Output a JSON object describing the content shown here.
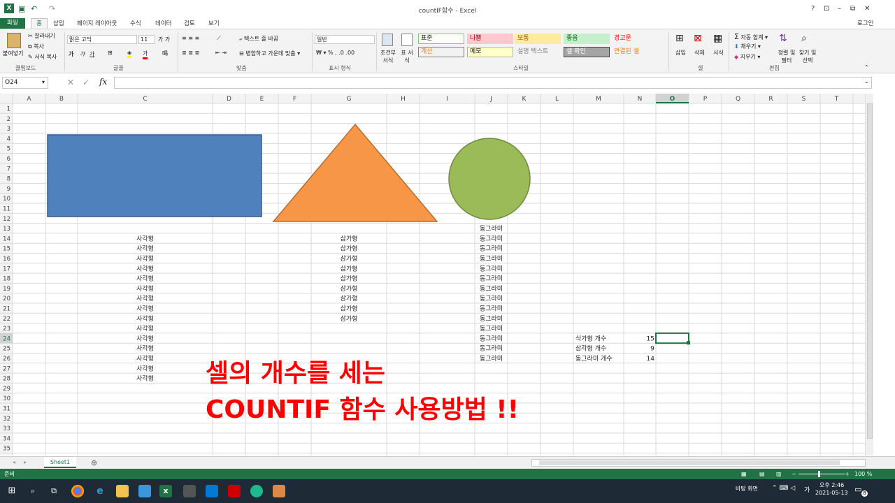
{
  "window": {
    "title": "countIF함수 - Excel",
    "login": "로그인",
    "controls": [
      "?",
      "⊡",
      "–",
      "⧉",
      "✕"
    ]
  },
  "tabs": [
    "파일",
    "홈",
    "삽입",
    "페이지 레이아웃",
    "수식",
    "데이터",
    "검토",
    "보기"
  ],
  "ribbon": {
    "clipboard": {
      "paste": "붙여넣기",
      "cut": "잘라내기",
      "copy": "복사",
      "format_painter": "서식 복사",
      "label": "클립보드"
    },
    "font": {
      "name": "맑은 고딕",
      "size": "11",
      "label": "글꼴",
      "bold": "가",
      "italic": "가",
      "underline": "가"
    },
    "align": {
      "wrap": "텍스트 줄 바꿈",
      "merge": "병합하고 가운데 맞춤",
      "label": "맞춤"
    },
    "number": {
      "format": "일반",
      "label": "표시 형식"
    },
    "styles": {
      "conditional": "조건부 서식",
      "table": "표 서식",
      "label": "스타일",
      "cells": [
        {
          "text": "표준",
          "bg": "#ffffff",
          "fg": "#222222",
          "border": "#7fc67f"
        },
        {
          "text": "나쁨",
          "bg": "#ffc7ce",
          "fg": "#9c0006",
          "border": "#ffc7ce"
        },
        {
          "text": "보통",
          "bg": "#ffeb9c",
          "fg": "#9c5700",
          "border": "#ffeb9c"
        },
        {
          "text": "좋음",
          "bg": "#c6efce",
          "fg": "#006100",
          "border": "#c6efce"
        },
        {
          "text": "경고문",
          "bg": "#f3f3f3",
          "fg": "#ff0000",
          "border": "#f3f3f3"
        },
        {
          "text": "계산",
          "bg": "#f2f2f2",
          "fg": "#fa7d00",
          "border": "#7f7f7f"
        },
        {
          "text": "메모",
          "bg": "#ffffcc",
          "fg": "#222222",
          "border": "#b2b2b2"
        },
        {
          "text": "설명 텍스트",
          "bg": "#f3f3f3",
          "fg": "#7f7f7f",
          "border": "#f3f3f3"
        },
        {
          "text": "셀 확인",
          "bg": "#a5a5a5",
          "fg": "#ffffff",
          "border": "#3f3f3f"
        },
        {
          "text": "연결된 셀",
          "bg": "#f3f3f3",
          "fg": "#fa7d00",
          "border": "#f3f3f3"
        }
      ]
    },
    "cells": {
      "insert": "삽입",
      "delete": "삭제",
      "format": "서식",
      "label": "셀"
    },
    "editing": {
      "autosum": "자동 합계",
      "fill": "채우기",
      "clear": "지우기",
      "sort": "정렬 및 필터",
      "find": "찾기 및 선택",
      "label": "편집"
    }
  },
  "formula_bar": {
    "cell_ref": "O24",
    "fx": "fx",
    "value": ""
  },
  "columns": [
    "A",
    "B",
    "C",
    "D",
    "E",
    "F",
    "G",
    "H",
    "I",
    "J",
    "K",
    "L",
    "M",
    "N",
    "O",
    "P",
    "Q",
    "R",
    "S",
    "T"
  ],
  "selected_cell": "O24",
  "cells": [
    {
      "ref": "J13",
      "text": "동그라미"
    },
    {
      "ref": "C14",
      "text": "사각형"
    },
    {
      "ref": "G14",
      "text": "삼가형"
    },
    {
      "ref": "J14",
      "text": "동그라미"
    },
    {
      "ref": "C15",
      "text": "사각형"
    },
    {
      "ref": "G15",
      "text": "삼가형"
    },
    {
      "ref": "J15",
      "text": "동그라미"
    },
    {
      "ref": "C16",
      "text": "사각형"
    },
    {
      "ref": "G16",
      "text": "삼가형"
    },
    {
      "ref": "J16",
      "text": "동그라미"
    },
    {
      "ref": "C17",
      "text": "사각형"
    },
    {
      "ref": "G17",
      "text": "삼가형"
    },
    {
      "ref": "J17",
      "text": "동그라미"
    },
    {
      "ref": "C18",
      "text": "사각형"
    },
    {
      "ref": "G18",
      "text": "삼가형"
    },
    {
      "ref": "J18",
      "text": "동그라미"
    },
    {
      "ref": "C19",
      "text": "사각형"
    },
    {
      "ref": "G19",
      "text": "삼가형"
    },
    {
      "ref": "J19",
      "text": "동그라미"
    },
    {
      "ref": "C20",
      "text": "사각형"
    },
    {
      "ref": "G20",
      "text": "삼가형"
    },
    {
      "ref": "J20",
      "text": "동그라미"
    },
    {
      "ref": "C21",
      "text": "사각형"
    },
    {
      "ref": "G21",
      "text": "삼가형"
    },
    {
      "ref": "J21",
      "text": "동그라미"
    },
    {
      "ref": "C22",
      "text": "사각형"
    },
    {
      "ref": "G22",
      "text": "삼가형"
    },
    {
      "ref": "J22",
      "text": "동그라미"
    },
    {
      "ref": "C23",
      "text": "사각형"
    },
    {
      "ref": "J23",
      "text": "동그라미"
    },
    {
      "ref": "C24",
      "text": "사각형"
    },
    {
      "ref": "J24",
      "text": "동그라미"
    },
    {
      "ref": "M24",
      "text": "삭가형 개수"
    },
    {
      "ref": "N24",
      "text": "15"
    },
    {
      "ref": "C25",
      "text": "사각형"
    },
    {
      "ref": "J25",
      "text": "동그라미"
    },
    {
      "ref": "M25",
      "text": "삼각형 개수"
    },
    {
      "ref": "N25",
      "text": "9"
    },
    {
      "ref": "C26",
      "text": "사각형"
    },
    {
      "ref": "J26",
      "text": "동그라미"
    },
    {
      "ref": "M26",
      "text": "동그라미 개수"
    },
    {
      "ref": "N26",
      "text": "14"
    },
    {
      "ref": "C27",
      "text": "사각형"
    },
    {
      "ref": "C28",
      "text": "사각형"
    }
  ],
  "shapes": {
    "rectangle": {
      "color": "#4f81bd"
    },
    "triangle": {
      "color": "#f79646"
    },
    "circle": {
      "color": "#9bbb59"
    }
  },
  "overlay": {
    "line1": "셀의 개수를 세는",
    "line2": "COUNTIF 함수 사용방법 !!",
    "color": "#ff0000"
  },
  "sheet": {
    "tab": "Sheet1"
  },
  "status": {
    "ready": "준비",
    "zoom": "100 %"
  },
  "taskbar": {
    "desktop": "바탕 화면",
    "ime": "가",
    "time": "오후 2:46",
    "date": "2021-05-13",
    "badge": "8"
  }
}
